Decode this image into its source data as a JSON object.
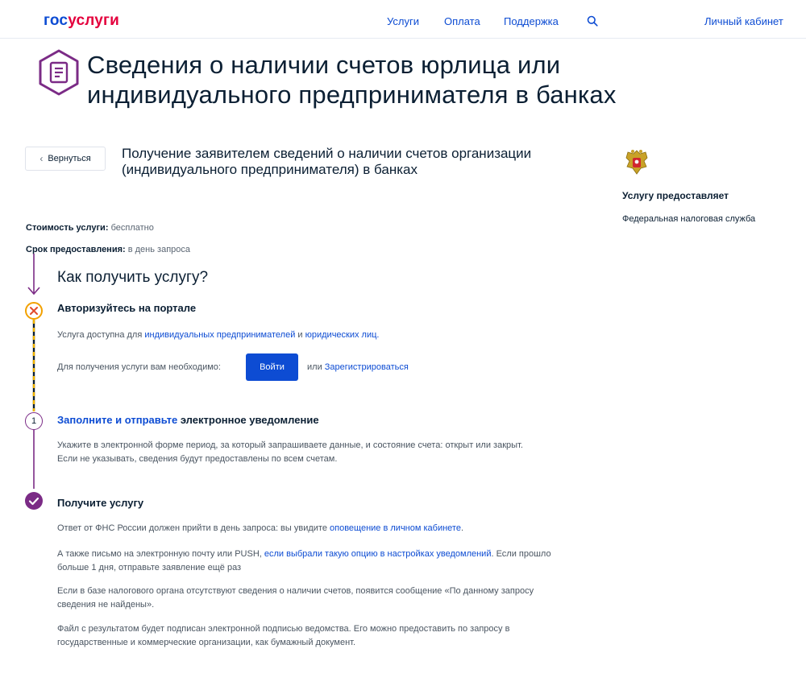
{
  "header": {
    "logo_part1": "гос",
    "logo_part2": "услуги",
    "nav": [
      "Услуги",
      "Оплата",
      "Поддержка"
    ],
    "account": "Личный кабинет"
  },
  "page_title": "Сведения о наличии счетов юрлица или индивидуального предпринимателя в банках",
  "back_label": "Вернуться",
  "service_title": "Получение заявителем сведений о наличии счетов организации (индивидуального предпринимателя) в банках",
  "provider": {
    "label": "Услугу предоставляет",
    "name": "Федеральная налоговая служба"
  },
  "meta": {
    "cost_label": "Стоимость услуги:",
    "cost_value": "бесплатно",
    "term_label": "Срок предоставления:",
    "term_value": "в день запроса"
  },
  "howto_title": "Как получить услугу?",
  "step1": {
    "title": "Авторизуйтесь на портале",
    "avail_prefix": "Услуга доступна для",
    "avail_link1": "индивидуальных предпринимателей",
    "avail_and": "и",
    "avail_link2": "юридических лиц.",
    "need_text": "Для получения услуги вам необходимо:",
    "login_btn": "Войти",
    "or_text": "или",
    "register_link": "Зарегистрироваться"
  },
  "step2": {
    "number": "1",
    "title_link": "Заполните и отправьте",
    "title_rest": "электронное уведомление",
    "text": "Укажите в электронной форме период, за который запрашиваете данные, и состояние счета: открыт или закрыт. Если не указывать, сведения будут предоставлены по всем счетам."
  },
  "step3": {
    "title": "Получите услугу",
    "p1_text": "Ответ от ФНС России должен прийти в день запроса: вы увидите",
    "p1_link": "оповещение в личном кабинете",
    "p1_end": ".",
    "p2_text": "А также письмо на электронную почту или PUSH,",
    "p2_link": "если выбрали такую опцию в настройках уведомлений",
    "p2_end": ". Если прошло больше 1 дня, отправьте заявление ещё раз",
    "p3": "Если в базе налогового органа отсутствуют сведения о наличии счетов, появится сообщение «По данному запросу сведения не найдены».",
    "p4": "Файл с результатом будет подписан электронной подписью ведомства. Его можно предоставить по запросу в государственные и коммерческие организации, как бумажный документ."
  },
  "colors": {
    "brand_blue": "#0d4cd3",
    "brand_red": "#e4003d",
    "purple": "#7b2b86",
    "warning": "#f2a100",
    "error_x": "#e24b2c"
  }
}
